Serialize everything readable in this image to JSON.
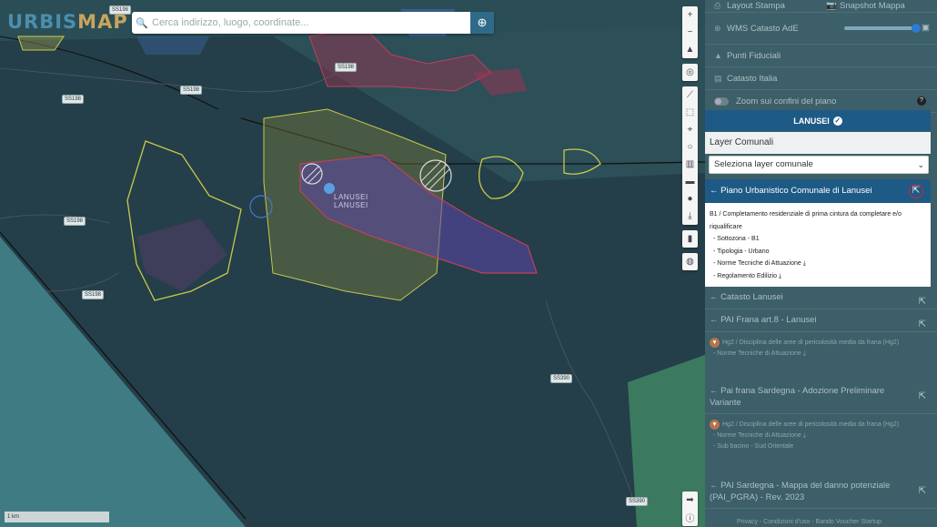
{
  "app": {
    "logo_a": "URBIS",
    "logo_b": "MAP"
  },
  "search": {
    "placeholder": "Cerca indirizzo, luogo, coordinate..."
  },
  "map": {
    "roads": [
      "SS198",
      "SS198",
      "SS198",
      "SS198",
      "SS198",
      "SS198",
      "SS390",
      "SS390"
    ],
    "town": "LANUSEI\nLANUSEI",
    "scale_label": "1 km"
  },
  "panel": {
    "layout_stampa": "Layout Stampa",
    "snapshot_mappa": "Snapshot Mappa",
    "wms": "WMS Catasto AdE",
    "punti_fiduciali": "Punti Fiduciali",
    "catasto_italia": "Catasto Italia",
    "zoom_confini": "Zoom sui confini del piano",
    "comune": "LANUSEI",
    "layer_comunali": "Layer Comunali",
    "select_placeholder": "Seleziona layer comunale",
    "puc_title": "Piano Urbanistico Comunale di Lanusei",
    "puc_desc": "B1 / Completamento residenziale di prima cintura da completare e/o riqualificare",
    "puc_items": [
      "- Sottozona - B1",
      "- Tipologia - Urbano",
      "- Norme Tecniche di Attuazione",
      "- Regolamento Edilizio"
    ],
    "catasto_lanusei": "Catasto Lanusei",
    "pai_frana": "PAI Frana art.8 - Lanusei",
    "hg2_desc": "Hg2 / Disciplina delle aree di pericolosità media da frana (Hg2)",
    "hg2_norme": "- Norme Tecniche di Attuazione",
    "pai_sardegna": "Pai frana Sardegna - Adozione Preliminare Variante",
    "hg2_desc2": "Hg2 / Disciplina delle aree di pericolosità media da frana (Hg2)",
    "hg2_norme2": "- Norme Tecniche di Attuazione",
    "sub_bacino": "- Sub bacino - Sud Orientale",
    "pai_danno": "PAI Sardegna - Mappa del danno potenziale (PAI_PGRA) - Rev. 2023",
    "footer": "Privacy - Condizioni d'uso - Bando Voucher Startup"
  },
  "colors": {
    "panel_bg": "#3c5f69",
    "accent": "#1e5a86",
    "map_bg": "#2a4d57"
  }
}
